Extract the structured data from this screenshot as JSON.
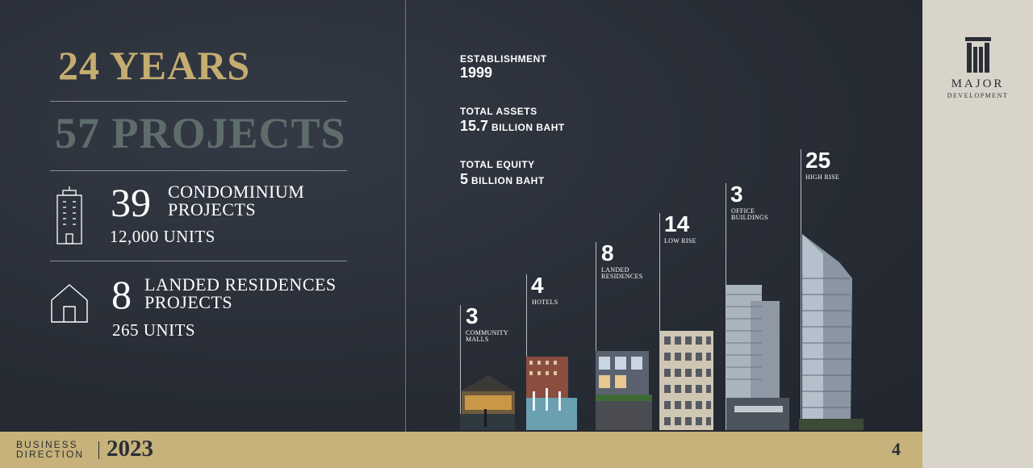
{
  "headline": {
    "years": "24 YEARS",
    "projects": "57 PROJECTS"
  },
  "condominium": {
    "count": "39",
    "label_line1": "CONDOMINIUM",
    "label_line2": "PROJECTS",
    "units": "12,000 UNITS",
    "icon": "building-icon"
  },
  "landed": {
    "count": "8",
    "label_line1": "LANDED RESIDENCES",
    "label_line2": "PROJECTS",
    "units": "265 UNITS",
    "icon": "house-icon"
  },
  "stats": {
    "establishment_label": "ESTABLISHMENT",
    "establishment_value": "1999",
    "assets_label": "TOTAL ASSETS",
    "assets_value": "15.7",
    "assets_unit": "BILLION BAHT",
    "equity_label": "TOTAL EQUITY",
    "equity_value": "5",
    "equity_unit": "BILLION BAHT"
  },
  "categories": [
    {
      "count": "3",
      "line1": "COMMUNITY",
      "line2": "MALLS"
    },
    {
      "count": "4",
      "line1": "HOTELS",
      "line2": ""
    },
    {
      "count": "8",
      "line1": "LANDED",
      "line2": "RESIDENCES"
    },
    {
      "count": "14",
      "line1": "LOW RISE",
      "line2": ""
    },
    {
      "count": "3",
      "line1": "OFFICE",
      "line2": "BUILDINGS"
    },
    {
      "count": "25",
      "line1": "HIGH RISE",
      "line2": ""
    }
  ],
  "footer": {
    "business": "BUSINESS",
    "direction": "DIRECTION",
    "year": "2023",
    "page": "4"
  },
  "logo": {
    "word1": "MAJOR",
    "word2": "DEVELOPMENT"
  },
  "colors": {
    "gold": "#c5ad70",
    "slate": "#5e6d6c",
    "background": "#272c35",
    "footer": "#c6b27a"
  }
}
